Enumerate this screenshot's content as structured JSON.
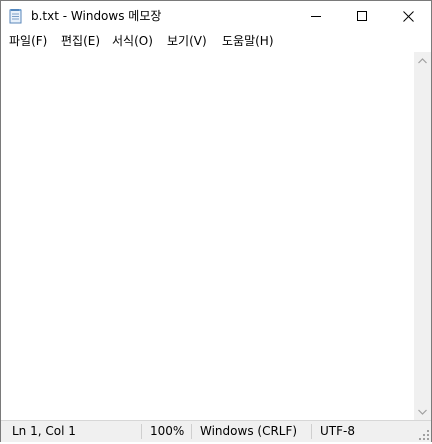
{
  "window": {
    "title": "b.txt - Windows 메모장"
  },
  "icons": {
    "app": "notepad-icon",
    "minimize": "minimize-icon",
    "maximize": "maximize-icon",
    "close": "close-icon",
    "scroll_up": "chevron-up-icon",
    "scroll_down": "chevron-down-icon",
    "grip": "resize-grip-icon"
  },
  "menu": {
    "file": "파일(F)",
    "edit": "편집(E)",
    "format": "서식(O)",
    "view": "보기(V)",
    "help": "도움말(H)"
  },
  "editor": {
    "content": ""
  },
  "status": {
    "position": "Ln 1, Col 1",
    "zoom": "100%",
    "line_ending": "Windows (CRLF)",
    "encoding": "UTF-8"
  },
  "colors": {
    "chrome": "#f0f0f0",
    "background": "#ffffff",
    "border": "#7a7a7a"
  }
}
